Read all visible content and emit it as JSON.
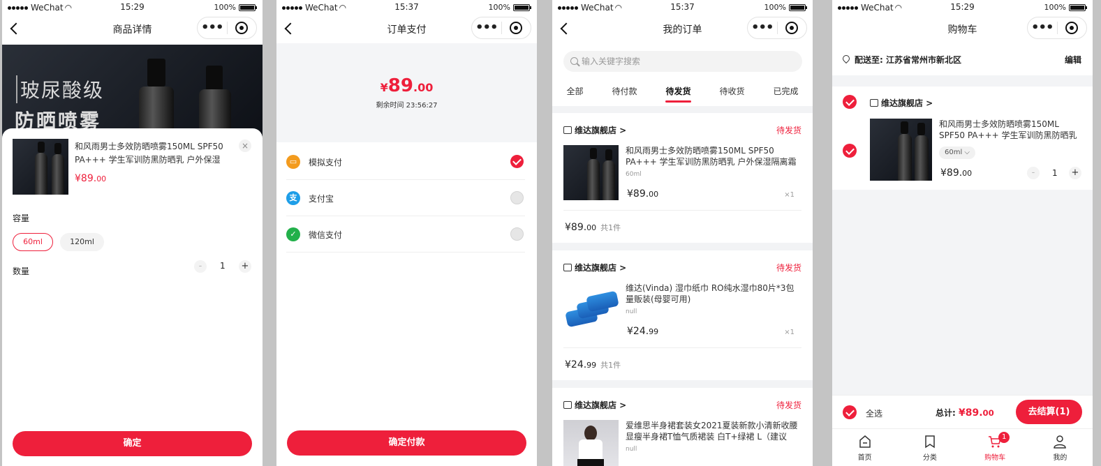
{
  "status": {
    "carrier": "WeChat",
    "battery": "100%",
    "times": [
      "15:29",
      "15:37",
      "15:37",
      "15:29"
    ]
  },
  "detail": {
    "nav_title": "商品详情",
    "hero_line1": "玻尿酸级",
    "hero_line2": "防晒喷雾",
    "product_title": "和风雨男士多效防晒喷雾150ML SPF50 PA+++ 学生军训防黑防晒乳 户外保湿隔…",
    "price_symbol": "¥",
    "price_int": "89.",
    "price_dec": "00",
    "close": "×",
    "capacity_label": "容量",
    "capacity_options": [
      "60ml",
      "120ml"
    ],
    "quantity_label": "数量",
    "minus": "-",
    "qty": "1",
    "plus": "+",
    "confirm_button": "确定"
  },
  "payment": {
    "nav_title": "订单支付",
    "amount_symbol": "¥",
    "amount_int": "89",
    "amount_dec": ".00",
    "remaining": "剩余时间 23:56:27",
    "methods": [
      {
        "name": "模拟支付",
        "icon": "wallet-icon",
        "color": "#f39b1e",
        "glyph": "▭",
        "selected": true
      },
      {
        "name": "支付宝",
        "icon": "alipay-icon",
        "color": "#1e9ee8",
        "glyph": "支",
        "selected": false
      },
      {
        "name": "微信支付",
        "icon": "wechat-pay-icon",
        "color": "#22b04a",
        "glyph": "✓",
        "selected": false
      }
    ],
    "confirm_button": "确定付款"
  },
  "orders": {
    "nav_title": "我的订单",
    "search_placeholder": "输入关键字搜索",
    "tabs": [
      "全部",
      "待付款",
      "待发货",
      "待收货",
      "已完成"
    ],
    "active_tab": "待发货",
    "items": [
      {
        "shop": "维达旗舰店 >",
        "status": "待发货",
        "title": "和风雨男士多效防晒喷雾150ML SPF50 PA+++ 学生军训防黑防晒乳 户外保湿隔离霜 抗水抗…",
        "spec": "60ml",
        "price_int": "¥89.",
        "price_dec": "00",
        "qty": "×1",
        "total_int": "¥89.",
        "total_dec": "00",
        "count": "共1件"
      },
      {
        "shop": "维达旗舰店 >",
        "status": "待发货",
        "title": "维达(Vinda) 湿巾纸巾 RO纯水湿巾80片*3包量贩装(母婴可用)",
        "spec": "null",
        "price_int": "¥24.",
        "price_dec": "99",
        "qty": "×1",
        "total_int": "¥24.",
        "total_dec": "99",
        "count": "共1件"
      },
      {
        "shop": "维达旗舰店 >",
        "status": "待发货",
        "title": "爱维思半身裙套装女2021夏装新款小清新收腰显瘦半身裙T恤气质裙装 白T+绿裙 L（建议105-…",
        "spec": "null"
      }
    ]
  },
  "cart": {
    "nav_title": "购物车",
    "address": "配送至: 江苏省常州市新北区",
    "edit": "编辑",
    "shop": "维达旗舰店 >",
    "item_title": "和风雨男士多效防晒喷雾150ML SPF50 PA+++ 学生军训防黑防晒乳 …",
    "spec": "60ml ⌵",
    "price_int": "¥89.",
    "price_dec": "00",
    "minus": "-",
    "qty": "1",
    "plus": "+",
    "select_all": "全选",
    "total_label": "总计: ",
    "total_int": "¥89.",
    "total_dec": "00",
    "checkout_button": "去结算(1)",
    "tabbar": [
      {
        "label": "首页",
        "icon": "home-icon"
      },
      {
        "label": "分类",
        "icon": "category-icon"
      },
      {
        "label": "购物车",
        "icon": "cart-icon",
        "badge": "1"
      },
      {
        "label": "我的",
        "icon": "profile-icon"
      }
    ]
  },
  "colors": {
    "accent": "#ee1f3b"
  }
}
